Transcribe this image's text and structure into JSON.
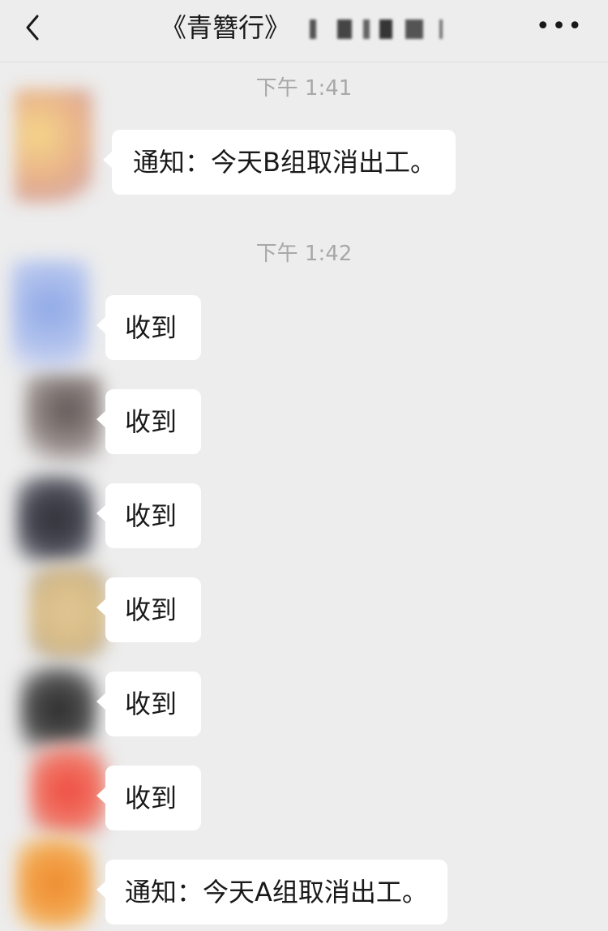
{
  "nav": {
    "title": "《青簪行》"
  },
  "messages": [
    {
      "type": "time",
      "text": "下午 1:41"
    },
    {
      "type": "msg",
      "text": "通知：今天B组取消出工。"
    },
    {
      "type": "time",
      "text": "下午 1:42"
    },
    {
      "type": "msg",
      "text": "收到"
    },
    {
      "type": "msg",
      "text": "收到"
    },
    {
      "type": "msg",
      "text": "收到"
    },
    {
      "type": "msg",
      "text": "收到"
    },
    {
      "type": "msg",
      "text": "收到"
    },
    {
      "type": "msg",
      "text": "收到"
    },
    {
      "type": "msg",
      "text": "通知：今天A组取消出工。"
    }
  ],
  "colors": {
    "background": "#ededed",
    "bubble": "#ffffff",
    "timestamp": "#a8a8a8",
    "text": "#191919"
  }
}
